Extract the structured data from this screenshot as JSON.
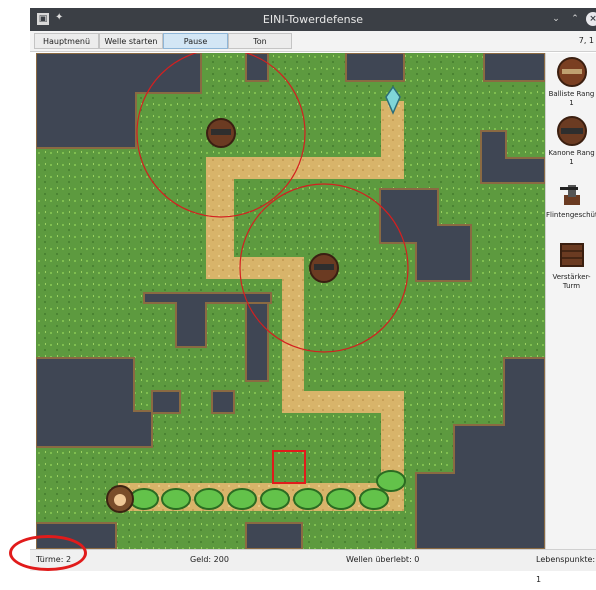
{
  "window": {
    "title": "EINI-Towerdefense"
  },
  "toolbar": {
    "buttons": [
      {
        "label": "Hauptmenü"
      },
      {
        "label": "Welle starten"
      },
      {
        "label": "Pause"
      },
      {
        "label": "Ton"
      }
    ],
    "coords": "7, 1"
  },
  "side_panel": {
    "towers": [
      {
        "label": "Balliste Rang 1",
        "icon": "ballista-icon"
      },
      {
        "label": "Kanone Rang 1",
        "icon": "cannon-icon"
      },
      {
        "label": "Flintengeschütz",
        "icon": "shotgun-turret-icon"
      },
      {
        "label": "Verstärker-Turm",
        "icon": "amplifier-tower-icon"
      }
    ]
  },
  "status": {
    "towers": "Türme: 2",
    "money": "Geld: 200",
    "waves": "Wellen überlebt: 0",
    "lives": "Lebenspunkte: 1"
  },
  "colors": {
    "grass": "#5d9a3f",
    "path": "#d8b46a",
    "water": "#3f4654",
    "range_ring": "#d32020",
    "titlebar": "#3b3f45"
  }
}
